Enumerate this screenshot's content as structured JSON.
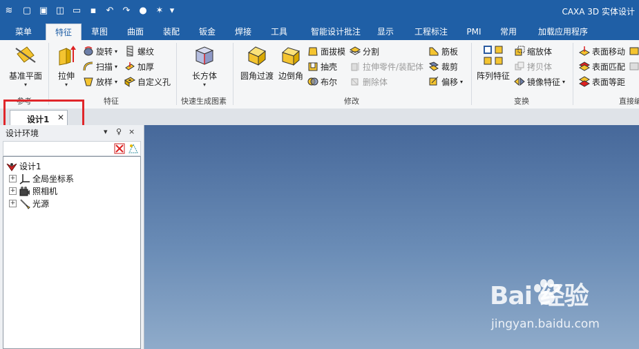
{
  "title": "CAXA 3D 实体设计",
  "quick_access": [
    "app-menu-icon",
    "new-icon",
    "open-icon",
    "import-icon",
    "folder-icon",
    "save-icon",
    "undo-icon",
    "redo-icon",
    "render-icon",
    "design-element-icon",
    "dropdown-icon"
  ],
  "tabs": [
    "菜单",
    "特征",
    "草图",
    "曲面",
    "装配",
    "钣金",
    "焊接",
    "工具",
    "智能设计批注",
    "显示",
    "工程标注",
    "PMI",
    "常用",
    "加载应用程序"
  ],
  "active_tab": "特征",
  "ribbon": {
    "ref_plane": "基准平面",
    "ref_group": "参考",
    "extrude": "拉伸",
    "revolve": "旋转",
    "sweep": "扫描",
    "loft": "放样",
    "thread": "螺纹",
    "thicken": "加厚",
    "custom_hole": "自定义孔",
    "feature_group": "特征",
    "cuboid": "长方体",
    "quick_group": "快速生成图素",
    "fillet": "圆角过渡",
    "chamfer": "边倒角",
    "draft": "面拔模",
    "shell": "抽壳",
    "boolean": "布尔",
    "split": "分割",
    "extrude_to_part": "拉伸零件/装配体",
    "delete_body": "删除体",
    "rib": "筋板",
    "trim": "裁剪",
    "offset": "偏移",
    "modify_group": "修改",
    "pattern": "阵列特征",
    "scale": "缩放体",
    "copy": "拷贝体",
    "mirror": "镜像特征",
    "transform_group": "变换",
    "face_move": "表面移动",
    "face_match": "表面匹配",
    "face_equidist": "表面等距",
    "direct_group": "直接编"
  },
  "doc_tab": "设计1",
  "panel": {
    "title": "设计环境",
    "pin": "♀",
    "close": "×",
    "dropdown": "▾"
  },
  "tree": [
    {
      "label": "设计1",
      "icon": "design-root-icon",
      "level": 0,
      "expander": ""
    },
    {
      "label": "全局坐标系",
      "icon": "coordinate-axes-icon",
      "level": 1,
      "expander": "+"
    },
    {
      "label": "照相机",
      "icon": "camera-icon",
      "level": 1,
      "expander": "+"
    },
    {
      "label": "光源",
      "icon": "light-icon",
      "level": 1,
      "expander": "+"
    }
  ],
  "watermark": {
    "main": "Bai  经验",
    "sub": "jingyan.baidu.com"
  },
  "colors": {
    "titlebar": "#1f5fa6",
    "highlight": "#e0262a",
    "viewport_top": "#46689a",
    "viewport_bottom": "#8fabca"
  }
}
